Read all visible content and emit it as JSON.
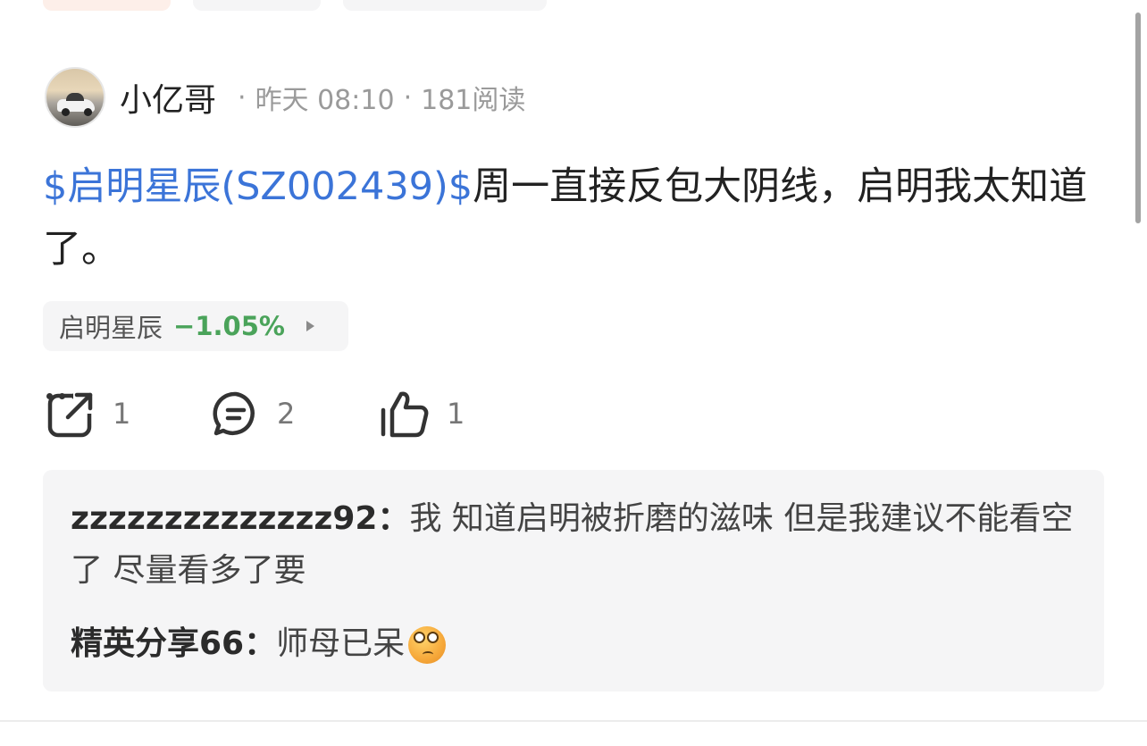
{
  "post": {
    "username": "小亿哥",
    "time": "昨天 08:10",
    "reads": "181阅读",
    "separator": "·",
    "stock_link": "$启明星辰(SZ002439)$",
    "text": "周一直接反包大阴线，启明我太知道了。"
  },
  "stock_chip": {
    "name": "启明星辰",
    "change": "−1.05%",
    "change_color": "#4aa35a"
  },
  "actions": {
    "share_count": "1",
    "comment_count": "2",
    "like_count": "1",
    "icons": [
      "share-icon",
      "comment-icon",
      "like-icon",
      "more-icon"
    ]
  },
  "comments": [
    {
      "author": "zzzzzzzzzzzzzz92：",
      "text": "我 知道启明被折磨的滋味 但是我建议不能看空了 尽量看多了要"
    },
    {
      "author": "精英分享66：",
      "text": "师母已呆",
      "emoji": "confused-face-emoji"
    }
  ],
  "colors": {
    "link": "#3b74d8",
    "muted": "#9a9a9a",
    "panel": "#f5f5f6"
  }
}
